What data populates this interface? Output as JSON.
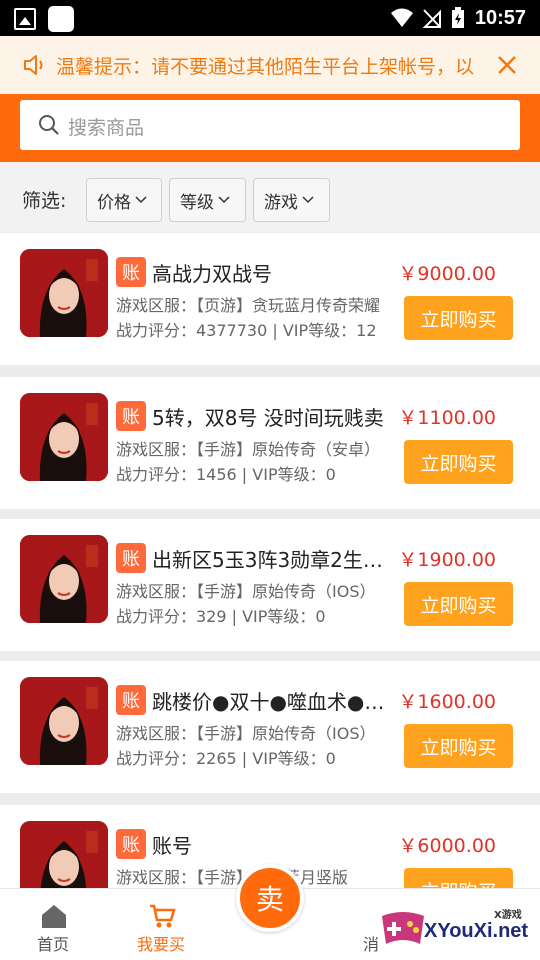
{
  "status_bar": {
    "time": "10:57"
  },
  "notice": {
    "text": "温馨提示：请不要通过其他陌生平台上架帐号，以"
  },
  "search": {
    "placeholder": "搜索商品"
  },
  "filter": {
    "label": "筛选:",
    "options": [
      "价格",
      "等级",
      "游戏"
    ]
  },
  "listings": [
    {
      "tag": "账",
      "title": "高战力双战号",
      "server": "游戏区服：【页游】贪玩蓝月传奇荣耀",
      "stats": "战力评分：4377730 | VIP等级：12",
      "price": "￥9000.00",
      "buy_label": "立即购买"
    },
    {
      "tag": "账",
      "title": "5转，双8号 没时间玩贱卖",
      "server": "游戏区服：【手游】原始传奇（安卓）",
      "stats": "战力评分：1456 | VIP等级：0",
      "price": "￥1100.00",
      "buy_label": "立即购买"
    },
    {
      "tag": "账",
      "title": "出新区5玉3阵3勋章2生肖…",
      "server": "游戏区服：【手游】原始传奇（IOS）",
      "stats": "战力评分：329 | VIP等级：0",
      "price": "￥1900.00",
      "buy_label": "立即购买"
    },
    {
      "tag": "账",
      "title": "跳楼价●双十●噬血术●…",
      "server": "游戏区服：【手游】原始传奇（IOS）",
      "stats": "战力评分：2265 | VIP等级：0",
      "price": "￥1600.00",
      "buy_label": "立即购买"
    },
    {
      "tag": "账",
      "title": "账号",
      "server": "游戏区服：【手游】贪玩蓝月竖版",
      "stats": "",
      "price": "￥6000.00",
      "buy_label": "立即购买"
    }
  ],
  "bottom_nav": {
    "home": "首页",
    "buy": "我要买",
    "sell": "卖",
    "msg": "消"
  },
  "watermark": {
    "text": "XYouXi.net",
    "small": "X游戏"
  },
  "colors": {
    "accent": "#ff6a0c",
    "buy_button": "#ffa21e",
    "price": "#e0332a",
    "notice_text": "#f07a10"
  }
}
